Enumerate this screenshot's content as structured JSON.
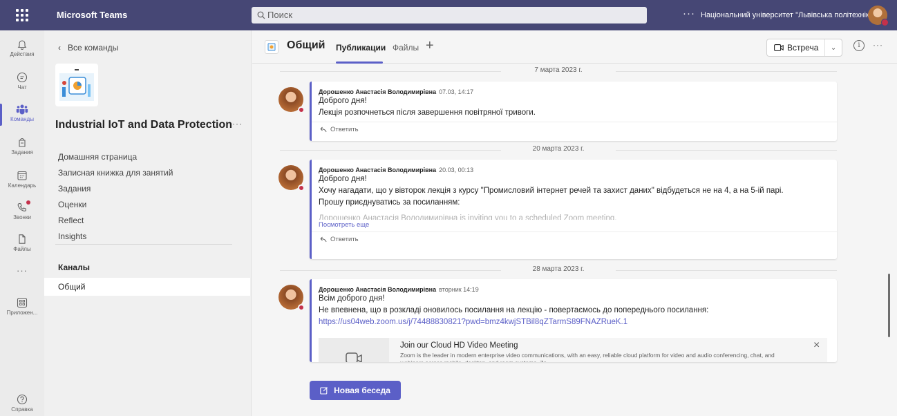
{
  "topbar": {
    "app_name": "Microsoft Teams",
    "search_placeholder": "Поиск",
    "more": "···",
    "org_name": "Національний університет \"Львівська політехніка\""
  },
  "rail": {
    "items": [
      {
        "label": "Действия",
        "icon": "bell-icon"
      },
      {
        "label": "Чат",
        "icon": "chat-icon"
      },
      {
        "label": "Команды",
        "icon": "teams-icon",
        "active": true
      },
      {
        "label": "Задания",
        "icon": "assignments-icon"
      },
      {
        "label": "Календарь",
        "icon": "calendar-icon"
      },
      {
        "label": "Звонки",
        "icon": "phone-icon"
      },
      {
        "label": "Файлы",
        "icon": "file-icon"
      },
      {
        "label": "Приложен...",
        "icon": "apps-icon"
      },
      {
        "label": "Справка",
        "icon": "help-icon"
      }
    ],
    "more": "···"
  },
  "team": {
    "back_label": "Все команды",
    "title": "Industrial IoT and Data Protection",
    "more": "···",
    "nav": [
      "Домашняя страница",
      "Записная книжка для занятий",
      "Задания",
      "Оценки",
      "Reflect",
      "Insights"
    ],
    "channels_heading": "Каналы",
    "channels": [
      "Общий"
    ]
  },
  "channel": {
    "name": "Общий",
    "tabs": [
      "Публикации",
      "Файлы"
    ],
    "add_tab": "+",
    "meet_label": "Встреча",
    "more": "···"
  },
  "feed": {
    "dates": [
      "7 марта 2023 г.",
      "20 марта 2023 г.",
      "28 марта 2023 г."
    ],
    "posts": [
      {
        "author": "Дорошенко Анастасія Володимирівна",
        "time": "07.03, 14:17",
        "lines": [
          "Доброго дня!",
          "Лекція розпочнеться після завершення повітряної тривоги."
        ],
        "reply": "Ответить"
      },
      {
        "author": "Дорошенко Анастасія Володимирівна",
        "time": "20.03, 00:13",
        "lines": [
          "Доброго дня!",
          "Хочу нагадати, що у вівторок лекція з курсу \"Промисловий інтернет речей та захист даних\" відбудеться не на 4, а на 5-ій парі.",
          "Прошу приєднуватись за посиланням:"
        ],
        "faded": "Дорошенко Анастасія Володимирівна is inviting you to a scheduled Zoom meeting.",
        "see_more": "Посмотреть еще",
        "reply": "Ответить"
      },
      {
        "author": "Дорошенко Анастасія Володимирівна",
        "time": "вторник 14:19",
        "lines": [
          "Всім доброго дня!",
          "Не впевнена, що в розкладі оновилось посилання на лекцію - повертаємось до попереднього посилання:"
        ],
        "link": "https://us04web.zoom.us/j/74488830821?pwd=bmz4kwjSTBil8qZTarmS89FNAZRueK.1",
        "preview": {
          "title": "Join our Cloud HD Video Meeting",
          "desc": "Zoom is the leader in modern enterprise video communications, with an easy, reliable cloud platform for video and audio conferencing, chat, and webinars across mobile, desktop, and room systems. Zo..."
        }
      }
    ]
  },
  "new_conversation": "Новая беседа",
  "colors": {
    "brand": "#464775",
    "accent": "#5b5fc7",
    "presence_busy": "#c4314b"
  }
}
